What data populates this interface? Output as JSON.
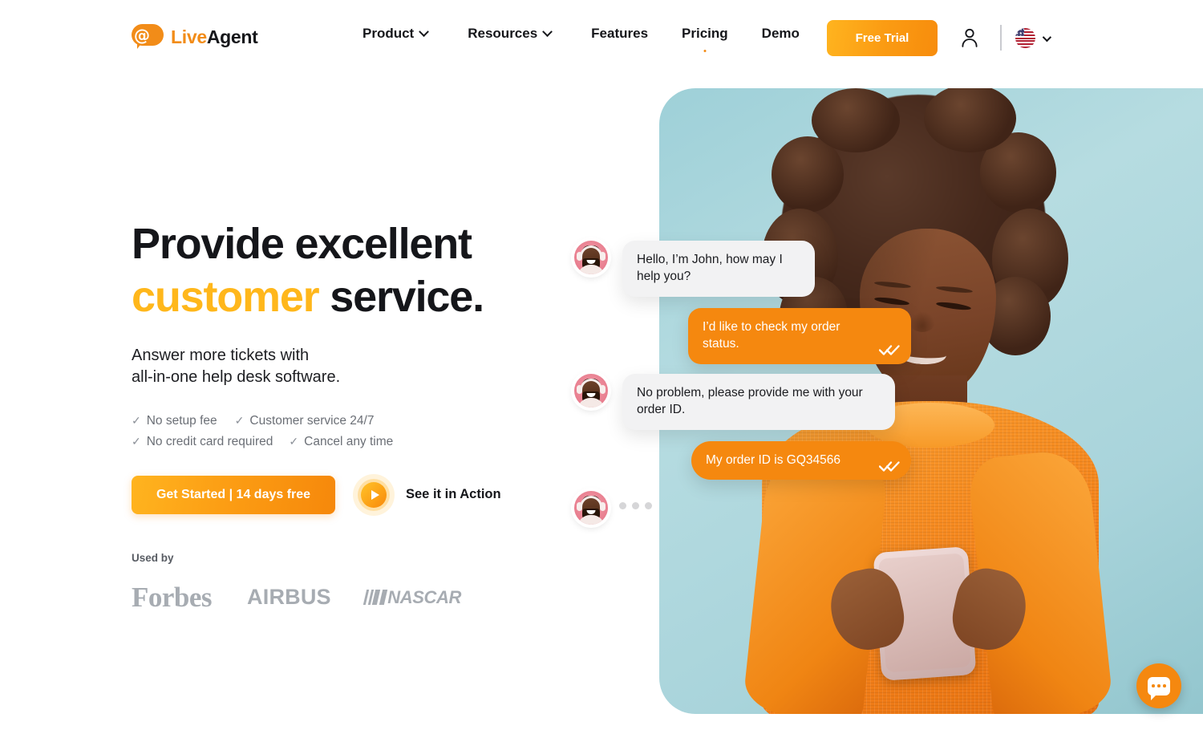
{
  "brand": {
    "name_part1": "Live",
    "name_part2": "Agent",
    "logo_glyph": "@",
    "accent_orange": "#F28C18",
    "accent_yellow": "#FFB71B"
  },
  "nav": {
    "items": [
      {
        "label": "Product",
        "has_chevron": true,
        "has_dot": false
      },
      {
        "label": "Resources",
        "has_chevron": true,
        "has_dot": false
      },
      {
        "label": "Features",
        "has_chevron": false,
        "has_dot": false
      },
      {
        "label": "Pricing",
        "has_chevron": false,
        "has_dot": true
      },
      {
        "label": "Demo",
        "has_chevron": false,
        "has_dot": false
      }
    ],
    "free_trial_label": "Free Trial",
    "account_icon": "user-icon",
    "language_flag": "us-flag-icon",
    "language_chevron": "chevron-down-icon"
  },
  "hero": {
    "headline_line1": "Provide excellent",
    "headline_line2_accent": "customer",
    "headline_line2_rest": " service.",
    "subhead_line1": "Answer more tickets with",
    "subhead_line2": "all-in-one help desk software.",
    "check_glyph": "✓",
    "features": [
      "No setup fee",
      "Customer service 24/7",
      "No credit card required",
      "Cancel any time"
    ],
    "cta_primary": "Get Started | 14 days free",
    "cta_secondary": "See it in Action",
    "play_icon": "play-icon"
  },
  "used_by": {
    "label": "Used by",
    "brands": [
      "Forbes",
      "AIRBUS",
      "NASCAR"
    ]
  },
  "chat": {
    "messages": [
      {
        "sender": "agent",
        "text": "Hello, I’m John, how may I help you?",
        "ticks": false
      },
      {
        "sender": "user",
        "text": "I’d like to check my order status.",
        "ticks": true
      },
      {
        "sender": "agent",
        "text": "No problem, please provide me with your order ID.",
        "ticks": false
      },
      {
        "sender": "user",
        "text": "My order ID is GQ34566",
        "ticks": true
      }
    ],
    "typing_indicator": true,
    "agent_bubble_color": "#F2F2F3",
    "user_bubble_color": "#F5880F",
    "avatar_name": "agent-avatar"
  },
  "chat_widget": {
    "icon": "chat-bubble-icon",
    "color": "#F5880F"
  }
}
